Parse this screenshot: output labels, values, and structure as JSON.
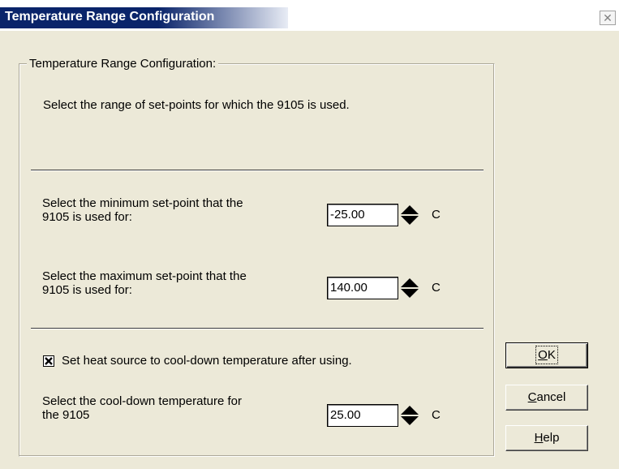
{
  "window": {
    "title": "Temperature Range Configuration",
    "close_glyph": "✕"
  },
  "group": {
    "legend": "Temperature Range Configuration:",
    "intro": "Select the range of set-points for which the 9105 is used."
  },
  "min_setpoint": {
    "label_line1": "Select the minimum set-point that the",
    "label_line2": "9105 is used for:",
    "value": "-25.00",
    "unit": "C"
  },
  "max_setpoint": {
    "label_line1": "Select the maximum set-point that the",
    "label_line2": "9105 is used for:",
    "value": "140.00",
    "unit": "C"
  },
  "cooldown": {
    "checkbox_label": "Set heat source to cool-down temperature after using.",
    "checked": true,
    "label_line1": "Select the cool-down temperature for",
    "label_line2": "the 9105",
    "value": "25.00",
    "unit": "C"
  },
  "buttons": {
    "ok": {
      "mnemonic": "O",
      "rest": "K"
    },
    "cancel": {
      "mnemonic": "C",
      "rest": "ancel"
    },
    "help": {
      "mnemonic": "H",
      "rest": "elp"
    }
  },
  "icons": {
    "spinner": "spin-up-down-icon",
    "check": "check-x-icon",
    "close": "close-icon"
  }
}
